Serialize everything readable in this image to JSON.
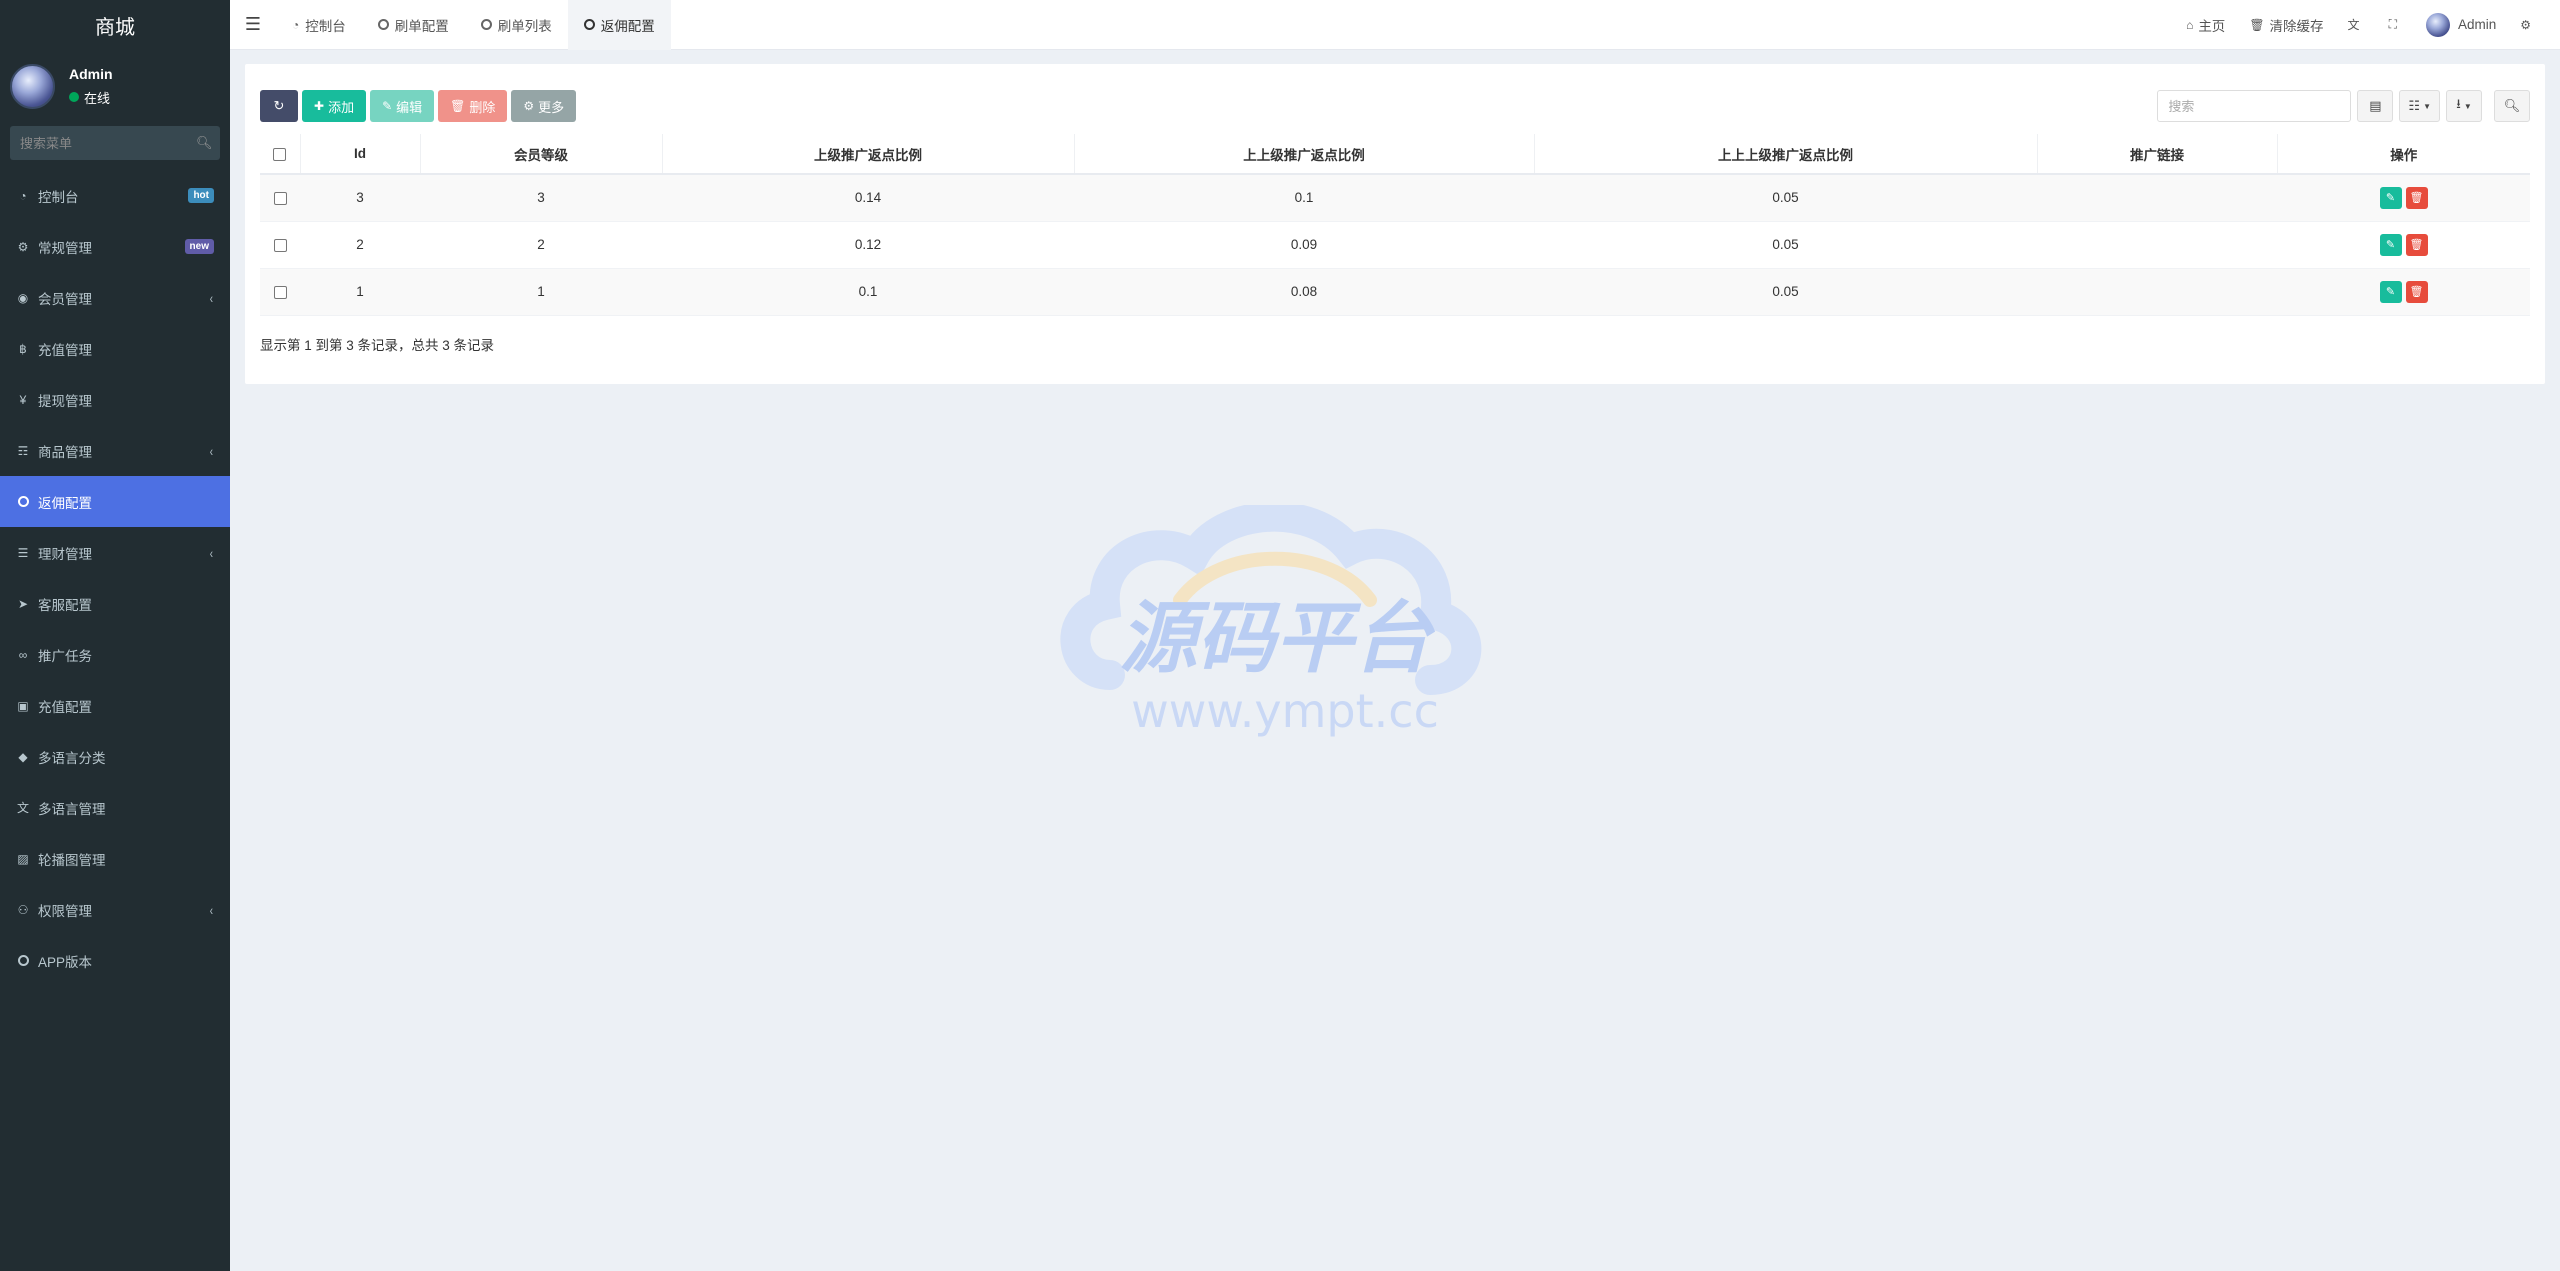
{
  "brand": "商城",
  "user": {
    "name": "Admin",
    "status": "在线"
  },
  "sidebar_search_placeholder": "搜索菜单",
  "menu": [
    {
      "label": "控制台",
      "icon": "dashboard-icon",
      "badge": "hot"
    },
    {
      "label": "常规管理",
      "icon": "cogs-icon",
      "badge": "new"
    },
    {
      "label": "会员管理",
      "icon": "user-circle-icon",
      "chevron": true
    },
    {
      "label": "充值管理",
      "icon": "bitcoin-icon"
    },
    {
      "label": "提现管理",
      "icon": "yen-icon"
    },
    {
      "label": "商品管理",
      "icon": "cart-icon",
      "chevron": true
    },
    {
      "label": "返佣配置",
      "icon": "circle-icon",
      "active": true
    },
    {
      "label": "理财管理",
      "icon": "list-icon",
      "chevron": true
    },
    {
      "label": "客服配置",
      "icon": "telegram-icon"
    },
    {
      "label": "推广任务",
      "icon": "link-icon"
    },
    {
      "label": "充值配置",
      "icon": "money-icon"
    },
    {
      "label": "多语言分类",
      "icon": "tag-icon"
    },
    {
      "label": "多语言管理",
      "icon": "language-icon"
    },
    {
      "label": "轮播图管理",
      "icon": "image-icon"
    },
    {
      "label": "权限管理",
      "icon": "users-icon",
      "chevron": true
    },
    {
      "label": "APP版本",
      "icon": "circle-icon"
    }
  ],
  "tabs": [
    {
      "label": "控制台",
      "icon": "dashboard-icon"
    },
    {
      "label": "刷单配置",
      "icon": "circle-icon"
    },
    {
      "label": "刷单列表",
      "icon": "circle-icon"
    },
    {
      "label": "返佣配置",
      "icon": "circle-icon",
      "active": true
    }
  ],
  "topbar": {
    "home": "主页",
    "clear_cache": "清除缓存",
    "admin": "Admin"
  },
  "toolbar": {
    "add": "添加",
    "edit": "编辑",
    "delete": "删除",
    "more": "更多"
  },
  "search_placeholder": "搜索",
  "table": {
    "columns": [
      "Id",
      "会员等级",
      "上级推广返点比例",
      "上上级推广返点比例",
      "上上上级推广返点比例",
      "推广链接",
      "操作"
    ],
    "rows": [
      {
        "id": "3",
        "level": "3",
        "rate1": "0.14",
        "rate2": "0.1",
        "rate3": "0.05",
        "link": ""
      },
      {
        "id": "2",
        "level": "2",
        "rate1": "0.12",
        "rate2": "0.09",
        "rate3": "0.05",
        "link": ""
      },
      {
        "id": "1",
        "level": "1",
        "rate1": "0.1",
        "rate2": "0.08",
        "rate3": "0.05",
        "link": ""
      }
    ]
  },
  "pager_text": "显示第 1 到第 3 条记录，总共 3 条记录",
  "watermark": {
    "title": "源码平台",
    "url": "www.ympt.cc"
  },
  "colors": {
    "sidebar": "#222d32",
    "active": "#4d70e3",
    "success": "#18bc9c",
    "danger": "#e74c3c"
  }
}
